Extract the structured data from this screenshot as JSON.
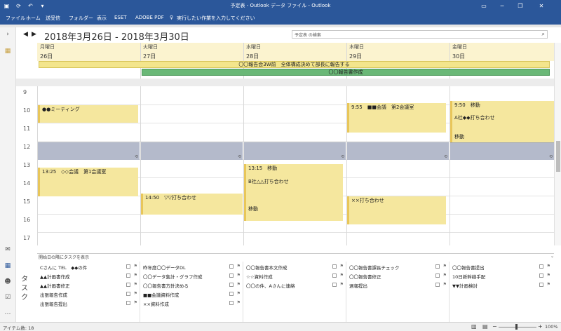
{
  "titlebar": {
    "title": "予定表 - Outlook データ ファイル - Outlook"
  },
  "ribbon": {
    "tabs": [
      "ファイル",
      "ホーム",
      "送受信",
      "フォルダー",
      "表示",
      "ESET",
      "ADOBE PDF"
    ],
    "tellme": "実行したい作業を入力してください"
  },
  "header": {
    "range": "2018年3月26日 - 2018年3月30日",
    "search_placeholder": "予定表 の検索"
  },
  "days": [
    {
      "name": "月曜日",
      "num": "26日"
    },
    {
      "name": "火曜日",
      "num": "27日"
    },
    {
      "name": "水曜日",
      "num": "28日"
    },
    {
      "name": "木曜日",
      "num": "29日"
    },
    {
      "name": "金曜日",
      "num": "30日"
    }
  ],
  "banners": [
    "〇〇報告会3W前　全体構成決めて部長に報告する",
    "〇〇報告書作成"
  ],
  "hours": [
    "9",
    "10",
    "11",
    "12",
    "13",
    "14",
    "15",
    "16",
    "17"
  ],
  "events": [
    {
      "text": "●●ミーティング"
    },
    {
      "text": "13:25　◇◇会議　第1会議室"
    },
    {
      "text": "14:50　▽▽打ち合わせ"
    },
    {
      "text": "13:15　移動"
    },
    {
      "text": "B社△△打ち合わせ"
    },
    {
      "text": "移動"
    },
    {
      "text": "9:55　■■会議　第2会議室"
    },
    {
      "text": "××打ち合わせ"
    },
    {
      "text": "9:50　移動"
    },
    {
      "text": "A社◆◆打ち合わせ"
    },
    {
      "text": "移動"
    }
  ],
  "tasks": {
    "header": "開始日の隣にタスクを表示",
    "label": "タスク",
    "columns": [
      [
        "Cさんに TEL　◆◆の件",
        "▲▲計画書作成",
        "▲▲計画書修正",
        "出張報告作成",
        "出張報告提出"
      ],
      [
        "昨年度〇〇データDL",
        "〇〇データ集計・グラフ作成",
        "〇〇報告書方針決める",
        "■■会議資料作成",
        "××資料作成"
      ],
      [
        "〇〇報告書本文作成",
        "☆☆資料作成",
        "〇〇の件、Aさんに連絡"
      ],
      [
        "〇〇報告書課長チェック",
        "〇〇報告書修正",
        "週報提出"
      ],
      [
        "〇〇報告書提出",
        "10日新幹線手配",
        "▼▼計画検討"
      ]
    ]
  },
  "status": {
    "items": "アイテム数: 18",
    "zoom": "100%"
  }
}
